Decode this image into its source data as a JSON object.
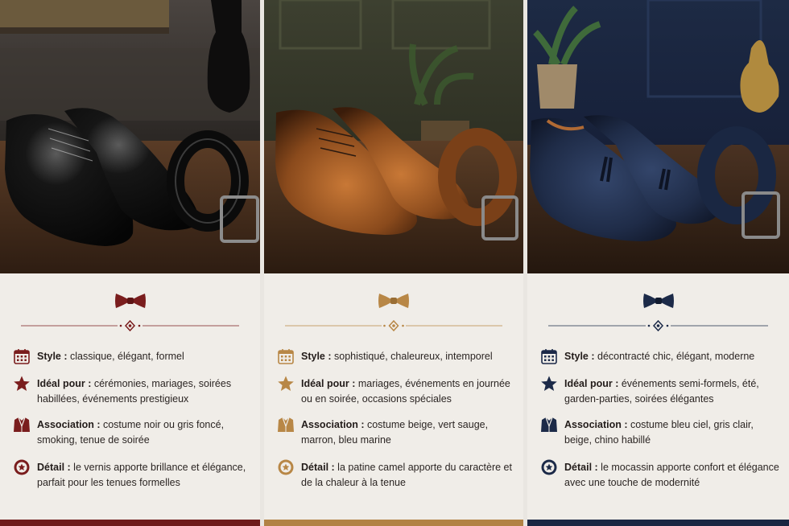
{
  "cards": [
    {
      "accent": "#7a1d1d",
      "photo_subject": "black patent leather oxford shoes and black belt",
      "rows": [
        {
          "label": "Style :",
          "text": "classique, élégant, formel",
          "icon": "calendar-icon"
        },
        {
          "label": "Idéal pour :",
          "text": "cérémonies, mariages, soirées habillées, événements prestigieux",
          "icon": "star-icon"
        },
        {
          "label": "Association :",
          "text": "costume noir ou gris foncé, smoking, tenue de soirée",
          "icon": "suit-jacket-icon"
        },
        {
          "label": "Détail :",
          "text": "le vernis apporte brillance et élégance, parfait pour les tenues formelles",
          "icon": "medal-icon"
        }
      ]
    },
    {
      "accent": "#b88746",
      "photo_subject": "cognac leather oxford shoes and brown belt",
      "rows": [
        {
          "label": "Style :",
          "text": "sophistiqué, chaleureux, intemporel",
          "icon": "calendar-icon"
        },
        {
          "label": "Idéal pour :",
          "text": "mariages, événements en journée ou en soirée, occasions spéciales",
          "icon": "star-icon"
        },
        {
          "label": "Association :",
          "text": "costume beige, vert sauge, marron, bleu marine",
          "icon": "suit-jacket-icon"
        },
        {
          "label": "Détail :",
          "text": "la patine camel apporte du caractère et de la chaleur à la tenue",
          "icon": "medal-icon"
        }
      ]
    },
    {
      "accent": "#1c2a48",
      "photo_subject": "navy suede tassel loafers and navy belt",
      "rows": [
        {
          "label": "Style :",
          "text": "décontracté chic, élégant, moderne",
          "icon": "calendar-icon"
        },
        {
          "label": "Idéal pour :",
          "text": "événements semi-formels, été, garden-parties, soirées élégantes",
          "icon": "star-icon"
        },
        {
          "label": "Association :",
          "text": "costume bleu ciel, gris clair, beige, chino habillé",
          "icon": "suit-jacket-icon"
        },
        {
          "label": "Détail :",
          "text": "le mocassin apporte confort et élégance avec une touche de modernité",
          "icon": "medal-icon"
        }
      ]
    }
  ]
}
